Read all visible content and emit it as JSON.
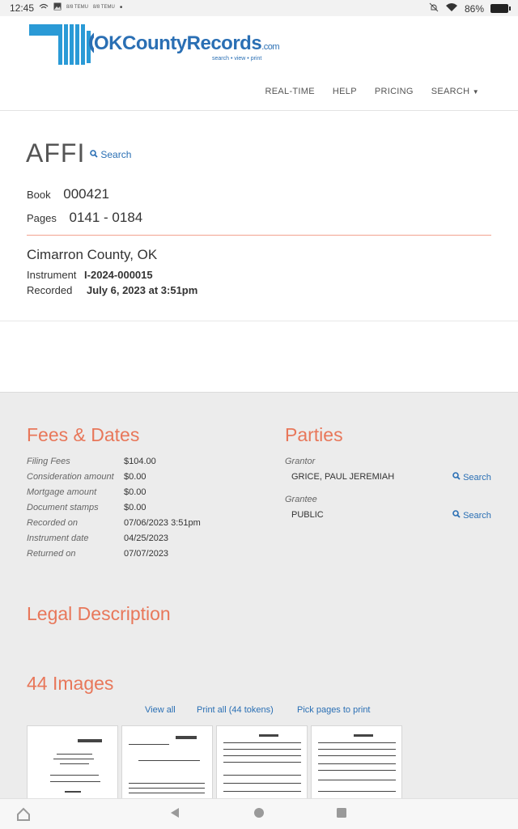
{
  "status_bar": {
    "time": "12:45",
    "battery": "86%",
    "notif_badges": [
      "8/8 TEMU",
      "8/8 TEMU"
    ],
    "icons": [
      "cast-icon",
      "image-icon",
      "temu-icon",
      "temu-icon",
      "dot-icon",
      "mute-icon",
      "wifi-icon",
      "battery-icon"
    ]
  },
  "header": {
    "logo_text": "OKCountyRecords",
    "logo_com": ".com",
    "logo_tagline": "search • view • print",
    "nav": [
      "REAL-TIME",
      "HELP",
      "PRICING",
      "SEARCH"
    ]
  },
  "record": {
    "doc_type": "AFFI",
    "search_label": "Search",
    "book_label": "Book",
    "book": "000421",
    "pages_label": "Pages",
    "pages": "0141 - 0184",
    "county": "Cimarron County, OK",
    "instrument_label": "Instrument",
    "instrument": "I-2024-000015",
    "recorded_label": "Recorded",
    "recorded": "July 6, 2023 at 3:51pm"
  },
  "fees": {
    "title": "Fees & Dates",
    "rows": [
      {
        "label": "Filing Fees",
        "value": "$104.00"
      },
      {
        "label": "Consideration amount",
        "value": "$0.00"
      },
      {
        "label": "Mortgage amount",
        "value": "$0.00"
      },
      {
        "label": "Document stamps",
        "value": "$0.00"
      },
      {
        "label": "Recorded on",
        "value": "07/06/2023 3:51pm"
      },
      {
        "label": "Instrument date",
        "value": "04/25/2023"
      },
      {
        "label": "Returned on",
        "value": "07/07/2023"
      }
    ]
  },
  "parties": {
    "title": "Parties",
    "grantor_label": "Grantor",
    "grantor": "GRICE, PAUL JEREMIAH",
    "grantee_label": "Grantee",
    "grantee": "PUBLIC",
    "search_label": "Search"
  },
  "legal": {
    "title": "Legal Description"
  },
  "images": {
    "title": "44 Images",
    "view_all": "View all",
    "print_all": "Print all (44 tokens)",
    "pick_pages": "Pick pages to print"
  },
  "navbar": {
    "icons": [
      "home-icon",
      "back-icon",
      "home-circle-icon",
      "recents-icon"
    ]
  }
}
